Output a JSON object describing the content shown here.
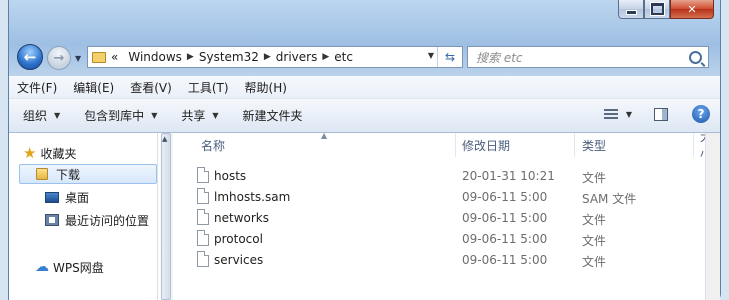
{
  "address": {
    "segments": [
      "«",
      "Windows",
      "System32",
      "drivers",
      "etc"
    ]
  },
  "search": {
    "placeholder": "搜索 etc"
  },
  "menubar": {
    "items": [
      "文件(F)",
      "编辑(E)",
      "查看(V)",
      "工具(T)",
      "帮助(H)"
    ]
  },
  "commandbar": {
    "organize": "组织",
    "include": "包含到库中",
    "share": "共享",
    "new_folder": "新建文件夹"
  },
  "navpane": {
    "favorites": "收藏夹",
    "downloads": "下载",
    "desktop": "桌面",
    "recent": "最近访问的位置",
    "wps": "WPS网盘"
  },
  "columns": {
    "name": "名称",
    "date": "修改日期",
    "type": "类型",
    "size": "大小"
  },
  "files": [
    {
      "name": "hosts",
      "date": "20-01-31 10:21",
      "type": "文件"
    },
    {
      "name": "lmhosts.sam",
      "date": "09-06-11 5:00",
      "type": "SAM 文件"
    },
    {
      "name": "networks",
      "date": "09-06-11 5:00",
      "type": "文件"
    },
    {
      "name": "protocol",
      "date": "09-06-11 5:00",
      "type": "文件"
    },
    {
      "name": "services",
      "date": "09-06-11 5:00",
      "type": "文件"
    }
  ]
}
